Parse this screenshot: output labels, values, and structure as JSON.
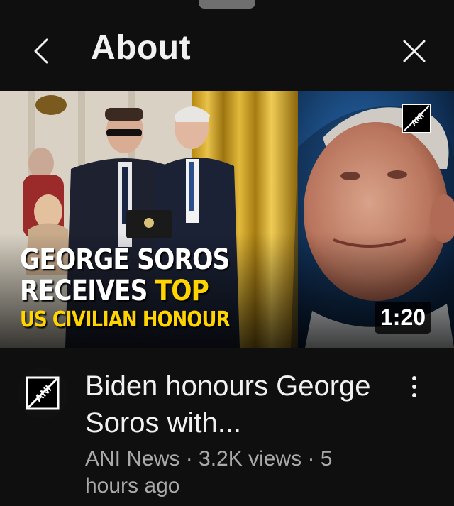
{
  "header": {
    "title": "About",
    "back_icon": "chevron-left-icon",
    "close_icon": "close-icon"
  },
  "video": {
    "thumbnail": {
      "headline_line1": "GEORGE SOROS",
      "headline_line2_a": "RECEIVES ",
      "headline_line2_b": "TOP",
      "headline_line3": "US CIVILIAN HONOUR",
      "duration": "1:20",
      "watermark": "ANI"
    },
    "title": "Biden honours George Soros with...",
    "channel": "ANI News",
    "separator": " · ",
    "views": "3.2K views",
    "age": "5 hours ago",
    "channel_avatar_text": "ANI"
  },
  "colors": {
    "background": "#0f0f0f",
    "text_primary": "#f1f1f1",
    "text_secondary": "#aaaaaa",
    "headline_yellow": "#ffd400"
  }
}
